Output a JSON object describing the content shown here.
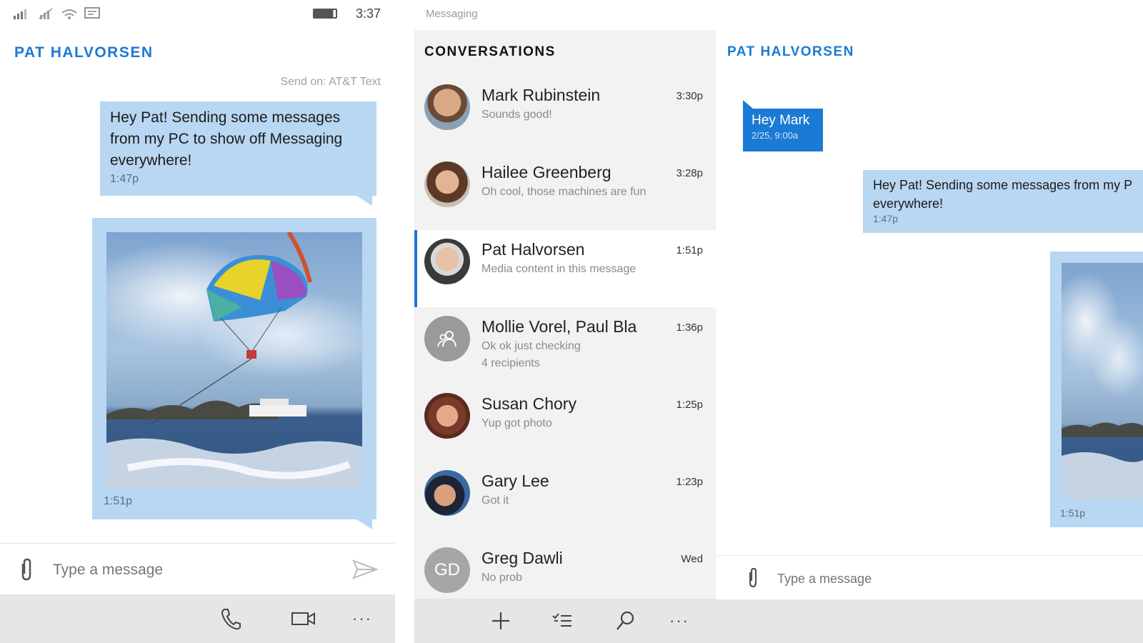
{
  "phone": {
    "status": {
      "time": "3:37"
    },
    "contact_name": "PAT HALVORSEN",
    "send_on": "Send on: AT&T Text",
    "messages": [
      {
        "text": "Hey Pat! Sending some messages from my PC to show off Messaging everywhere!",
        "time": "1:47p"
      },
      {
        "type": "photo",
        "time": "1:51p"
      }
    ],
    "compose": {
      "placeholder": "Type a message"
    },
    "app_bar": {
      "more": "···"
    }
  },
  "desktop": {
    "app_title": "Messaging",
    "conversations_header": "CONVERSATIONS",
    "conversations": [
      {
        "name": "Mark Rubinstein",
        "preview": "Sounds good!",
        "time": "3:30p",
        "avatar": "photo",
        "color": "#b07a55"
      },
      {
        "name": "Hailee Greenberg",
        "preview": "Oh cool, those machines are fun",
        "time": "3:28p",
        "avatar": "photo",
        "color": "#8a5a3c"
      },
      {
        "name": "Pat Halvorsen",
        "preview": "Media content in this message",
        "time": "1:51p",
        "avatar": "photo",
        "color": "#9c7d6a",
        "selected": true
      },
      {
        "name": "Mollie Vorel, Paul Bla",
        "preview": "Ok ok just checking",
        "extra": "4 recipients",
        "time": "1:36p",
        "avatar": "group-icon",
        "color": "#9a9a9a"
      },
      {
        "name": "Susan Chory",
        "preview": "Yup got photo",
        "time": "1:25p",
        "avatar": "photo",
        "color": "#8c4b3a"
      },
      {
        "name": "Gary Lee",
        "preview": "Got it",
        "time": "1:23p",
        "avatar": "photo",
        "color": "#3a4a6a"
      },
      {
        "name": "Greg Dawli",
        "preview": "No prob",
        "time": "Wed",
        "avatar": "initials",
        "initials": "GD",
        "color": "#a6a6a6"
      }
    ],
    "chat": {
      "contact_name": "PAT HALVORSEN",
      "incoming": {
        "text": "Hey Mark",
        "time": "2/25, 9:00a"
      },
      "outgoing": {
        "text_line1": "Hey Pat! Sending some messages from my P",
        "text_line2": "everywhere!",
        "time": "1:47p"
      },
      "photo_time": "1:51p",
      "compose": {
        "placeholder": "Type a message"
      }
    },
    "bottom_bar": {
      "more": "···"
    }
  },
  "colors": {
    "accent": "#1b7ad3",
    "bubble_out": "#b9d6f2",
    "bubble_in": "#1b7ad3",
    "app_bar": "#e6e6e6"
  }
}
